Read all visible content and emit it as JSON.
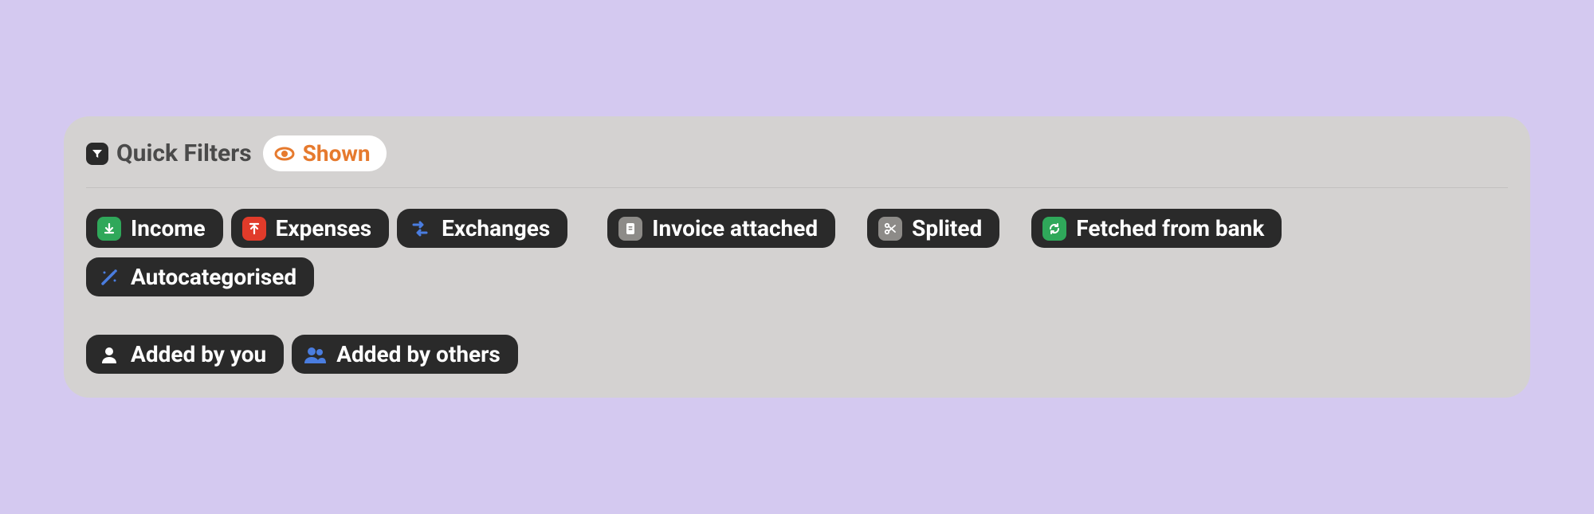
{
  "header": {
    "title": "Quick Filters",
    "toggle_label": "Shown"
  },
  "filters": {
    "income": "Income",
    "expenses": "Expenses",
    "exchanges": "Exchanges",
    "invoice_attached": "Invoice attached",
    "splited": "Splited",
    "fetched_from_bank": "Fetched from bank",
    "autocategorised": "Autocategorised",
    "added_by_you": "Added by you",
    "added_by_others": "Added by others"
  },
  "colors": {
    "income_icon_bg": "#2fa85a",
    "expenses_icon_bg": "#e13b2a",
    "exchanges_icon": "#4a7de0",
    "invoice_icon_bg": "#8d8b88",
    "splited_icon_bg": "#8d8b88",
    "fetched_icon_bg": "#2fa85a",
    "autocategorised_icon": "#4a7de0",
    "added_you_icon": "#ffffff",
    "added_others_icon": "#4a7de0",
    "shown_accent": "#e67a2e"
  }
}
